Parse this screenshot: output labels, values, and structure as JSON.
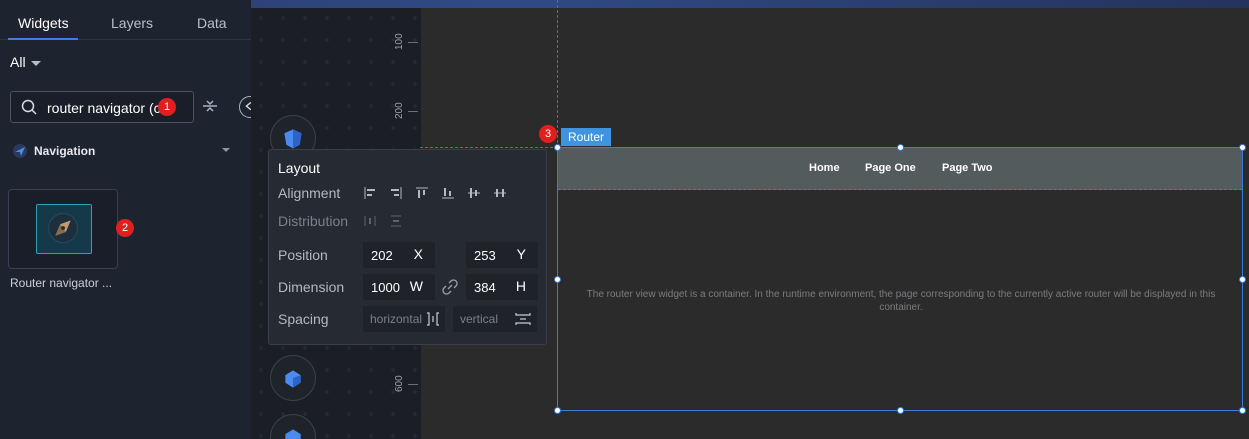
{
  "tabs": [
    {
      "label": "Widgets",
      "active": true
    },
    {
      "label": "Layers",
      "active": false
    },
    {
      "label": "Data",
      "active": false
    }
  ],
  "filter": {
    "label": "All"
  },
  "search": {
    "value": "router navigator (c"
  },
  "badges": {
    "one": "1",
    "two": "2",
    "three": "3"
  },
  "category": {
    "label": "Navigation"
  },
  "widget": {
    "caption": "Router navigator ..."
  },
  "ruler": {
    "labels": [
      "100",
      "200",
      "600"
    ]
  },
  "layout": {
    "title": "Layout",
    "alignment_label": "Alignment",
    "distribution_label": "Distribution",
    "position_label": "Position",
    "dimension_label": "Dimension",
    "spacing_label": "Spacing",
    "position_x": "202",
    "position_x_unit": "X",
    "position_y": "253",
    "position_y_unit": "Y",
    "width": "1000",
    "width_unit": "W",
    "height": "384",
    "height_unit": "H",
    "spacing_horizontal_placeholder": "horizontal",
    "spacing_vertical_placeholder": "vertical"
  },
  "router": {
    "tag": "Router",
    "nav_items": [
      "Home",
      "Page One",
      "Page Two"
    ],
    "description": "The router view widget is a container. In the runtime environment, the page corresponding to the currently active router will be displayed in this container."
  },
  "colors": {
    "accent": "#3f7ce8",
    "badge": "#e01f1f",
    "router_tag": "#3f94e0"
  }
}
